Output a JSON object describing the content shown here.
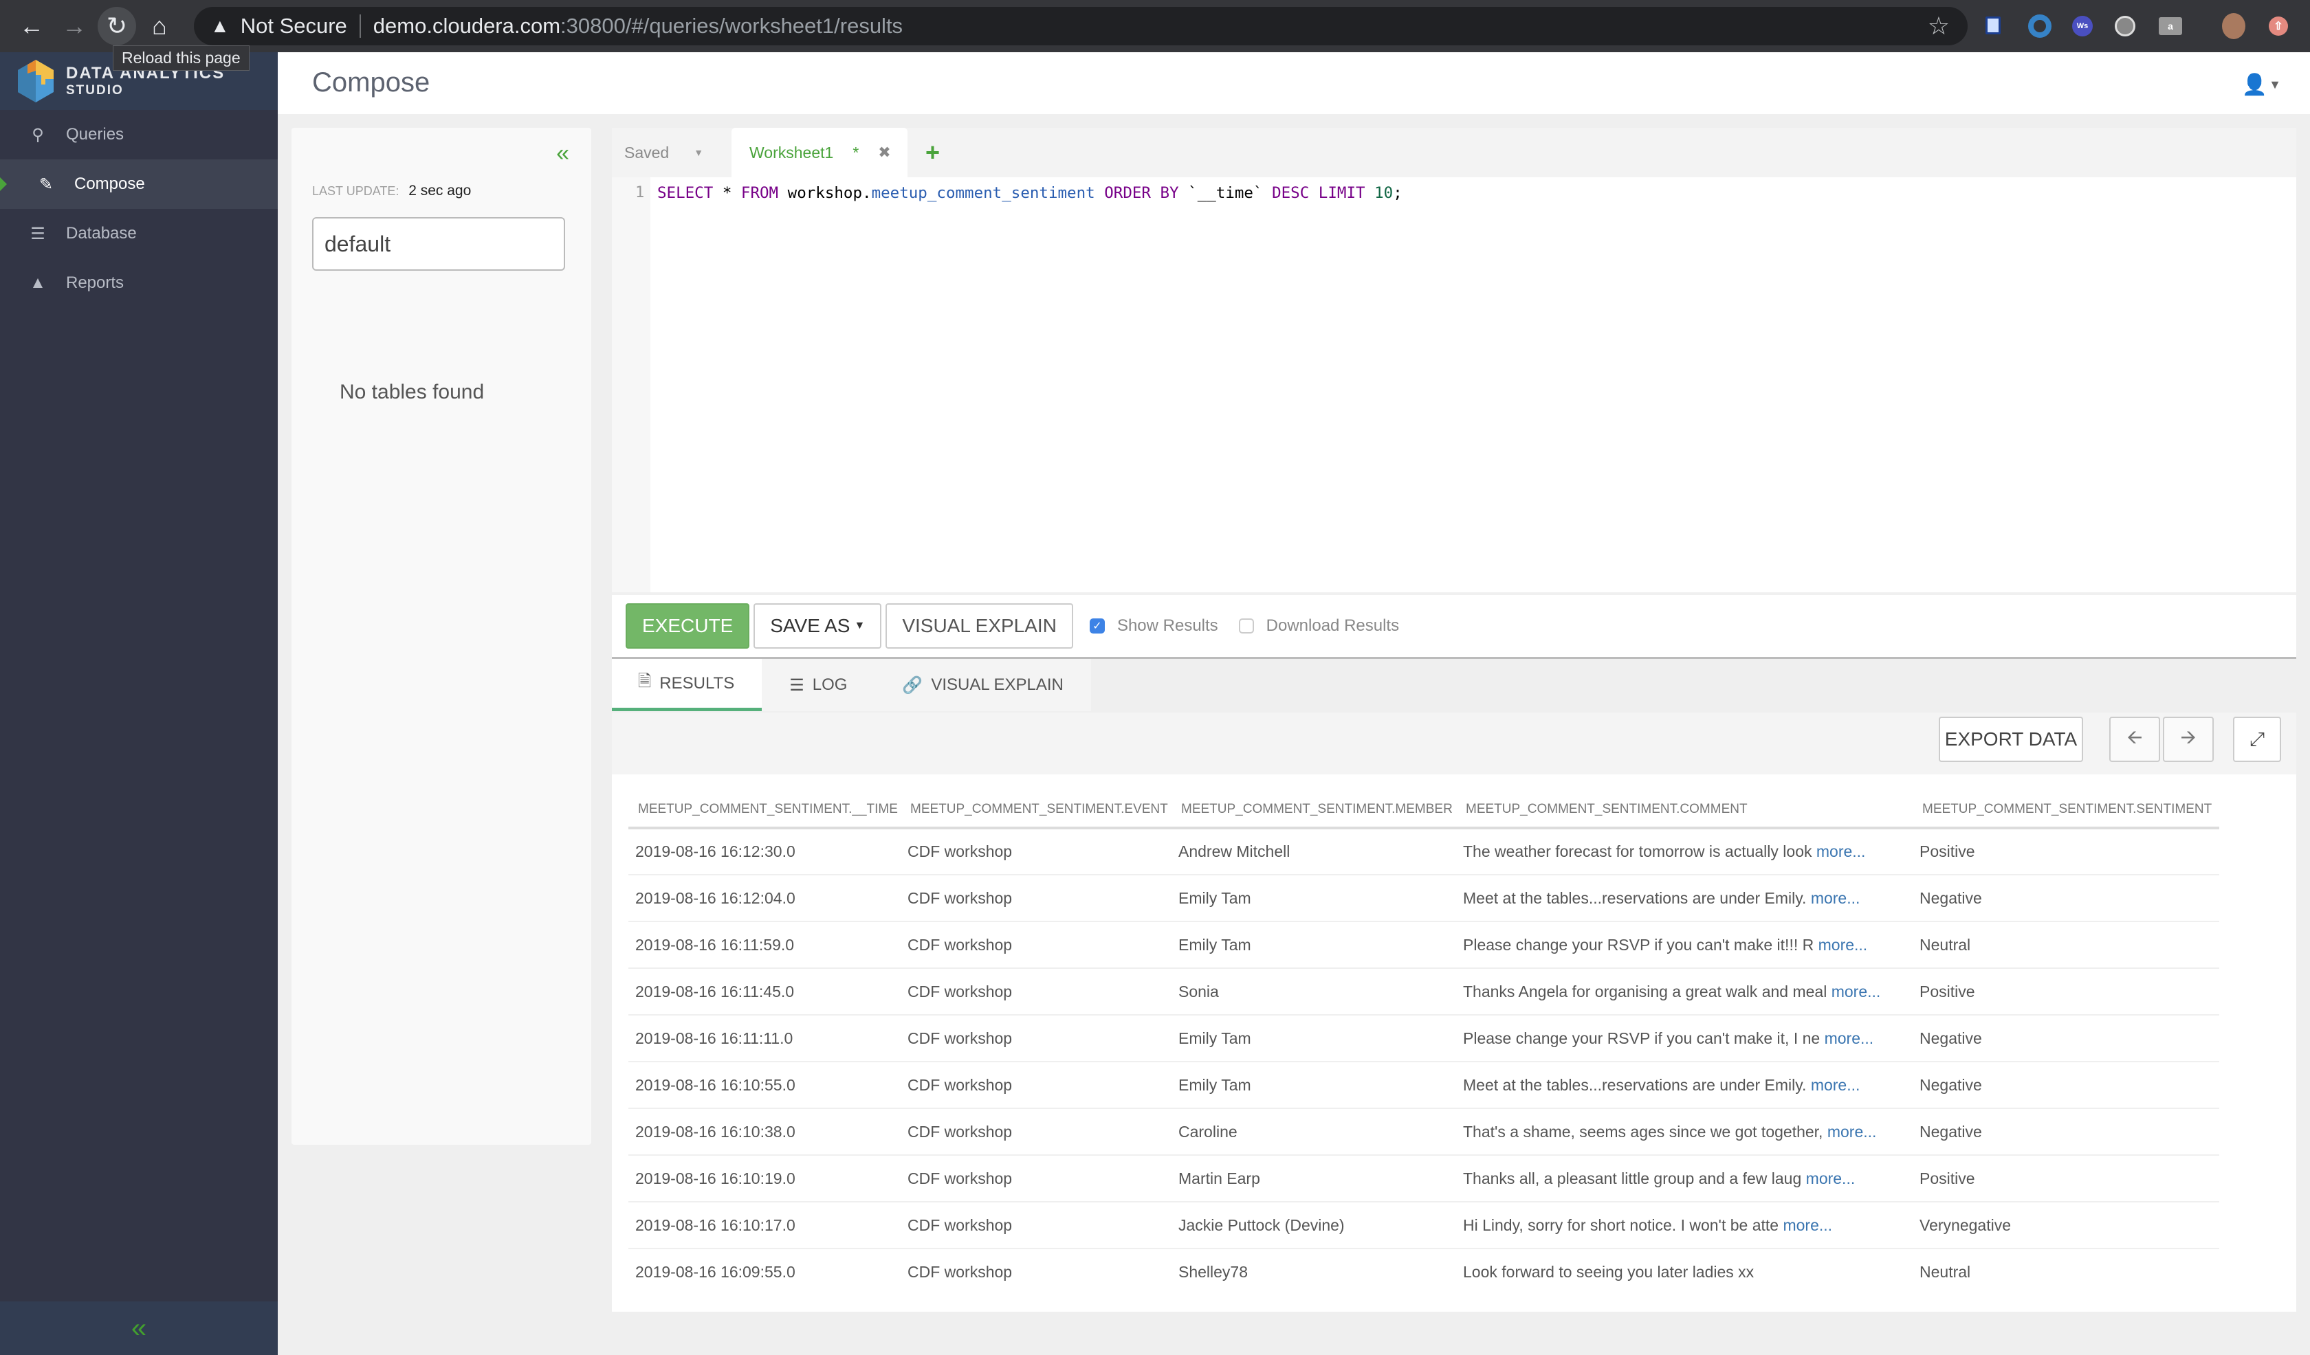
{
  "browser": {
    "security_label": "Not Secure",
    "url_host": "demo.cloudera.com",
    "url_path": ":30800/#/queries/worksheet1/results",
    "tooltip": "Reload this page",
    "extensions": [
      "screenshot-extension",
      "blue-ring-extension",
      "ws-extension",
      "grey-orb-extension",
      "chat-extension"
    ]
  },
  "app": {
    "brand_line1": "DATA ANALYTICS",
    "brand_line2": "STUDIO"
  },
  "sidebar": {
    "items": [
      {
        "label": "Queries",
        "icon": "search-icon",
        "active": false
      },
      {
        "label": "Compose",
        "icon": "edit-icon",
        "active": true
      },
      {
        "label": "Database",
        "icon": "database-icon",
        "active": false
      },
      {
        "label": "Reports",
        "icon": "area-chart-icon",
        "active": false
      }
    ]
  },
  "header": {
    "title": "Compose"
  },
  "db_panel": {
    "last_update_label": "LAST UPDATE:",
    "last_update_value": "2 sec ago",
    "database_value": "default",
    "empty_message": "No tables found"
  },
  "editor": {
    "saved_tab": "Saved",
    "worksheet_tab": "Worksheet1",
    "unsaved_marker": "*",
    "line_number": "1",
    "query_tokens": {
      "select": "SELECT",
      "star": " * ",
      "from": "FROM",
      "schema": " workshop.",
      "table": "meetup_comment_sentiment",
      "order": " ORDER BY ",
      "col": "`__time`",
      "desc": " DESC LIMIT ",
      "limit": "10",
      "end": ";"
    },
    "execute_label": "EXECUTE",
    "save_as_label": "SAVE AS",
    "visual_explain_label": "VISUAL EXPLAIN",
    "show_results_label": "Show Results",
    "show_results_checked": true,
    "download_results_label": "Download Results",
    "download_results_checked": false
  },
  "results": {
    "tabs": [
      {
        "label": "RESULTS",
        "icon": "file-icon",
        "active": true
      },
      {
        "label": "LOG",
        "icon": "list-icon",
        "active": false
      },
      {
        "label": "VISUAL EXPLAIN",
        "icon": "link-icon",
        "active": false
      }
    ],
    "export_label": "EXPORT DATA",
    "more_label": "more...",
    "columns": [
      "MEETUP_COMMENT_SENTIMENT.__TIME",
      "MEETUP_COMMENT_SENTIMENT.EVENT",
      "MEETUP_COMMENT_SENTIMENT.MEMBER",
      "MEETUP_COMMENT_SENTIMENT.COMMENT",
      "MEETUP_COMMENT_SENTIMENT.SENTIMENT"
    ],
    "rows": [
      {
        "time": "2019-08-16 16:12:30.0",
        "event": "CDF workshop",
        "member": "Andrew Mitchell",
        "comment": "The weather forecast for tomorrow is actually look",
        "truncated": true,
        "sentiment": "Positive"
      },
      {
        "time": "2019-08-16 16:12:04.0",
        "event": "CDF workshop",
        "member": "Emily Tam",
        "comment": "Meet at the tables...reservations are under Emily.",
        "truncated": true,
        "sentiment": "Negative"
      },
      {
        "time": "2019-08-16 16:11:59.0",
        "event": "CDF workshop",
        "member": "Emily Tam",
        "comment": "Please change your RSVP if you can't make it!!! R",
        "truncated": true,
        "sentiment": "Neutral"
      },
      {
        "time": "2019-08-16 16:11:45.0",
        "event": "CDF workshop",
        "member": "Sonia",
        "comment": "Thanks Angela for organising a great walk and meal",
        "truncated": true,
        "sentiment": "Positive"
      },
      {
        "time": "2019-08-16 16:11:11.0",
        "event": "CDF workshop",
        "member": "Emily Tam",
        "comment": "Please change your RSVP if you can't make it, I ne",
        "truncated": true,
        "sentiment": "Negative"
      },
      {
        "time": "2019-08-16 16:10:55.0",
        "event": "CDF workshop",
        "member": "Emily Tam",
        "comment": "Meet at the tables...reservations are under Emily.",
        "truncated": true,
        "sentiment": "Negative"
      },
      {
        "time": "2019-08-16 16:10:38.0",
        "event": "CDF workshop",
        "member": "Caroline",
        "comment": "That's a shame, seems ages since we got together,",
        "truncated": true,
        "sentiment": "Negative"
      },
      {
        "time": "2019-08-16 16:10:19.0",
        "event": "CDF workshop",
        "member": "Martin Earp",
        "comment": "Thanks all, a pleasant little group and a few laug",
        "truncated": true,
        "sentiment": "Positive"
      },
      {
        "time": "2019-08-16 16:10:17.0",
        "event": "CDF workshop",
        "member": "Jackie Puttock (Devine)",
        "comment": "Hi Lindy, sorry for short notice. I won't be atte",
        "truncated": true,
        "sentiment": "Verynegative"
      },
      {
        "time": "2019-08-16 16:09:55.0",
        "event": "CDF workshop",
        "member": "Shelley78",
        "comment": "Look forward to seeing you later ladies xx",
        "truncated": false,
        "sentiment": "Neutral"
      }
    ]
  }
}
